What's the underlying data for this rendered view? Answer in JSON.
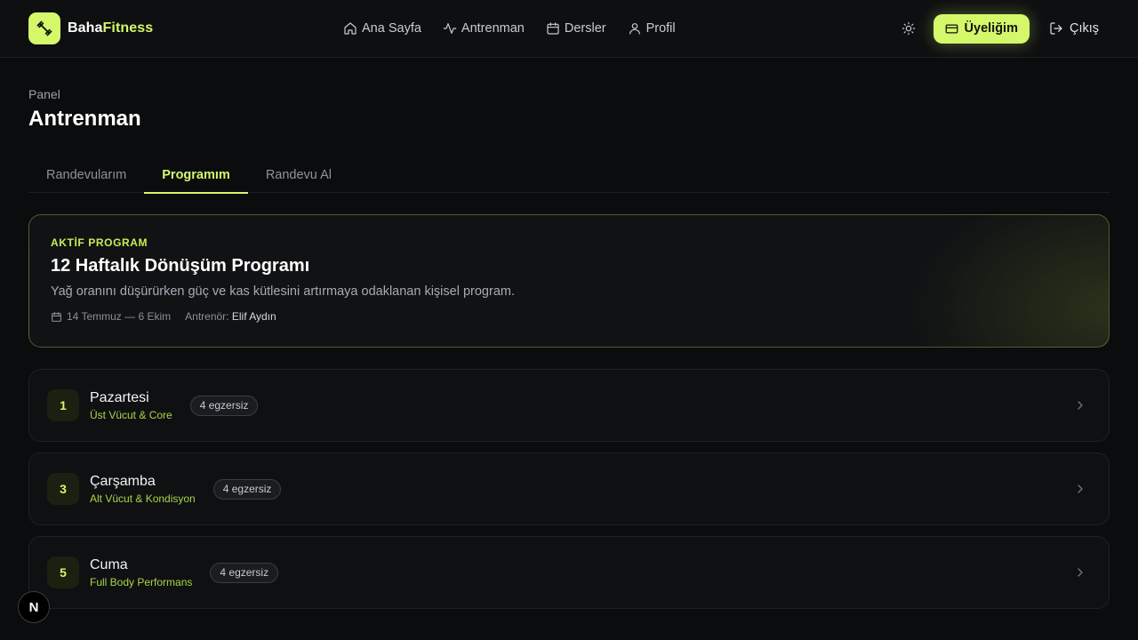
{
  "brand": {
    "name_part1": "Baha",
    "name_part2": "Fitness",
    "accent_color": "#d4f86a"
  },
  "nav": [
    {
      "label": "Ana Sayfa",
      "icon": "home-icon"
    },
    {
      "label": "Antrenman",
      "icon": "activity-icon"
    },
    {
      "label": "Dersler",
      "icon": "calendar-icon"
    },
    {
      "label": "Profil",
      "icon": "user-icon"
    }
  ],
  "header_actions": {
    "theme_icon": "sun-icon",
    "membership_label": "Üyeliğim",
    "logout_label": "Çıkış"
  },
  "page": {
    "breadcrumb": "Panel",
    "title": "Antrenman"
  },
  "tabs": [
    {
      "label": "Randevularım",
      "active": false
    },
    {
      "label": "Programım",
      "active": true
    },
    {
      "label": "Randevu Al",
      "active": false
    }
  ],
  "program": {
    "kicker": "AKTİF PROGRAM",
    "name": "12 Haftalık Dönüşüm Programı",
    "description": "Yağ oranını düşürürken güç ve kas kütlesini artırmaya odaklanan kişisel program.",
    "dates": "14 Temmuz — 6 Ekim",
    "coach_label": "Antrenör:",
    "coach_name": "Elif Aydın"
  },
  "days": [
    {
      "number": "1",
      "name": "Pazartesi",
      "focus": "Üst Vücut & Core",
      "badge": "4 egzersiz"
    },
    {
      "number": "3",
      "name": "Çarşamba",
      "focus": "Alt Vücut & Kondisyon",
      "badge": "4 egzersiz"
    },
    {
      "number": "5",
      "name": "Cuma",
      "focus": "Full Body Performans",
      "badge": "4 egzersiz"
    }
  ],
  "fab": {
    "letter": "N"
  }
}
